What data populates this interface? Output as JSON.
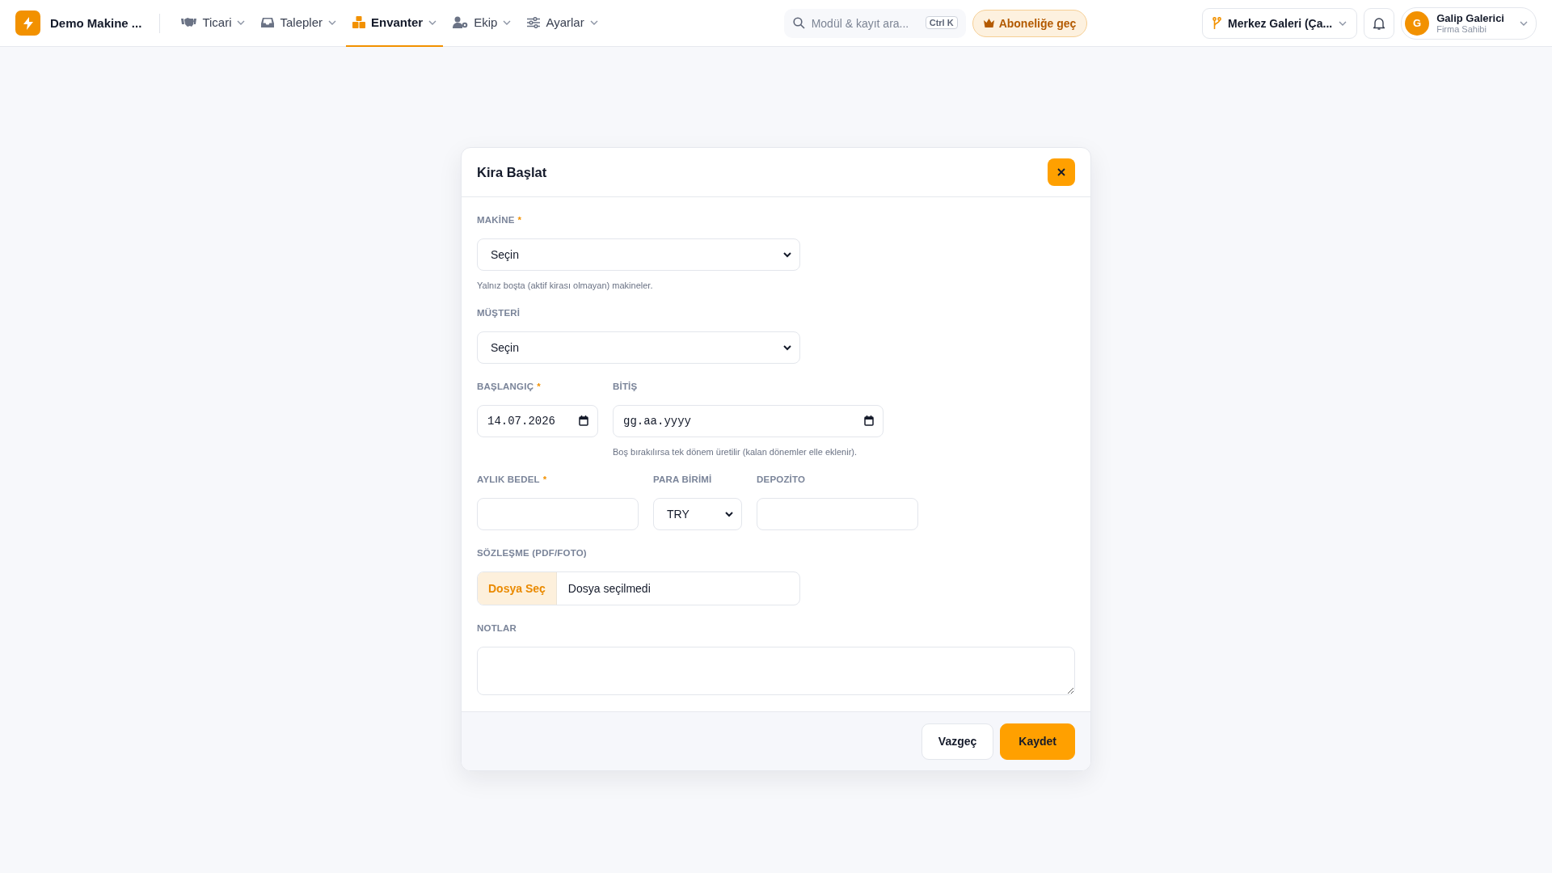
{
  "brand": {
    "name": "Demo Makine ..."
  },
  "nav": [
    {
      "label": "Ticari",
      "selected": false
    },
    {
      "label": "Talepler",
      "selected": false
    },
    {
      "label": "Envanter",
      "selected": true
    },
    {
      "label": "Ekip",
      "selected": false
    },
    {
      "label": "Ayarlar",
      "selected": false
    }
  ],
  "search": {
    "placeholder": "Modül & kayıt ara...",
    "shortcut": "Ctrl K"
  },
  "upgrade_button": "Aboneliğe geç",
  "branch": "Merkez Galeri (Ça...",
  "user": {
    "initial": "G",
    "name": "Galip Galerici",
    "role": "Firma Sahibi"
  },
  "modal": {
    "title": "Kira Başlat",
    "rows": [
      {
        "fields": [
          {
            "kind": "select",
            "label": "MAKİNE",
            "required_mark": "*",
            "value": "Seçin",
            "hint": "Yalnız boşta (aktif kirası olmayan) makineler."
          }
        ]
      },
      {
        "fields": [
          {
            "kind": "select",
            "label": "MÜŞTERİ",
            "value": "Seçin"
          }
        ]
      },
      {
        "fields": [
          {
            "kind": "date",
            "label": "BAŞLANGIÇ",
            "required_mark": "*",
            "value": "14.07.2026"
          },
          {
            "kind": "date",
            "label": "BİTİŞ",
            "placeholder": "gg.aa.yyyy",
            "hint": "Boş bırakılırsa tek dönem üretilir (kalan dönemler elle eklenir)."
          }
        ]
      },
      {
        "fields": [
          {
            "kind": "text",
            "label": "AYLIK BEDEL",
            "required_mark": "*"
          },
          {
            "kind": "select",
            "label": "PARA BİRİMİ",
            "value": "TRY"
          },
          {
            "kind": "text",
            "label": "DEPOZİTO"
          }
        ]
      },
      {
        "fields": [
          {
            "kind": "file",
            "label": "SÖZLEŞME (PDF/FOTO)",
            "button": "Dosya Seç",
            "status": "Dosya seçilmedi"
          }
        ]
      },
      {
        "fields": [
          {
            "kind": "textarea",
            "label": "NOTLAR"
          }
        ]
      }
    ],
    "buttons": [
      {
        "label": "Vazgeç",
        "kind": "secondary"
      },
      {
        "label": "Kaydet",
        "kind": "primary"
      }
    ]
  }
}
